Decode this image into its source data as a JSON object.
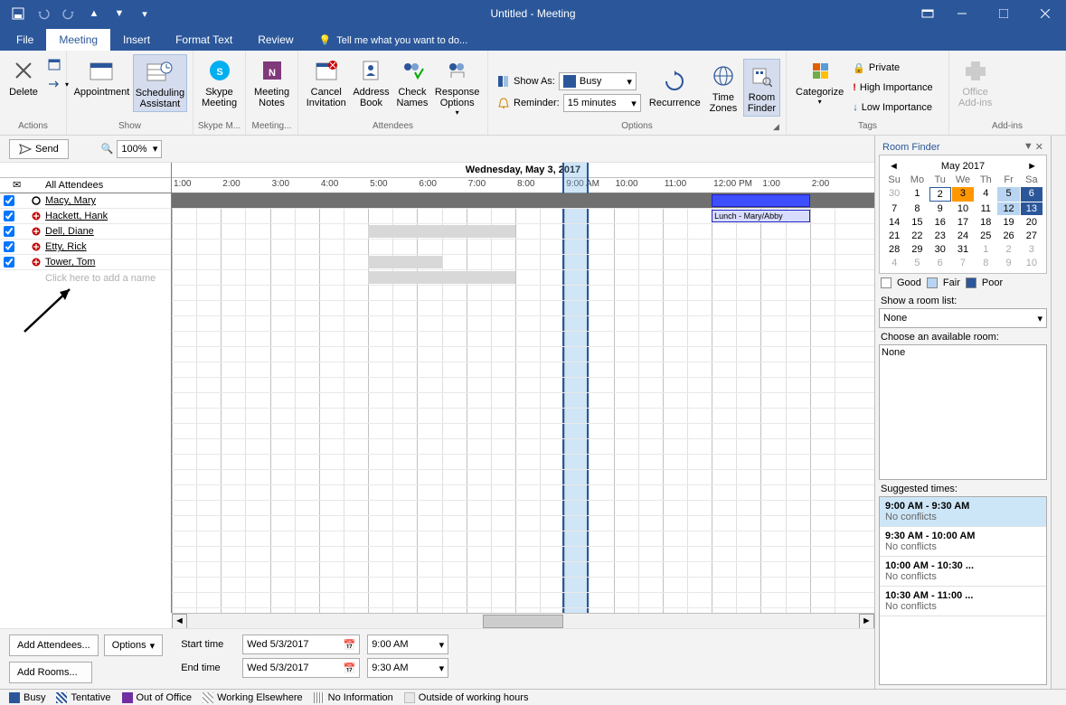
{
  "window": {
    "title": "Untitled - Meeting"
  },
  "tabs": {
    "file": "File",
    "meeting": "Meeting",
    "insert": "Insert",
    "formattext": "Format Text",
    "review": "Review",
    "tellme": "Tell me what you want to do..."
  },
  "ribbon": {
    "actions": {
      "delete": "Delete",
      "group": "Actions"
    },
    "show": {
      "appointment": "Appointment",
      "scheduling": "Scheduling\nAssistant",
      "group": "Show"
    },
    "skype": {
      "btn": "Skype\nMeeting",
      "group": "Skype M..."
    },
    "notes": {
      "btn": "Meeting\nNotes",
      "group": "Meeting..."
    },
    "attendees": {
      "cancel": "Cancel\nInvitation",
      "address": "Address\nBook",
      "check": "Check\nNames",
      "response": "Response\nOptions",
      "group": "Attendees"
    },
    "options": {
      "showas_lbl": "Show As:",
      "showas_val": "Busy",
      "reminder_lbl": "Reminder:",
      "reminder_val": "15 minutes",
      "recurrence": "Recurrence",
      "timezones": "Time\nZones",
      "roomfinder": "Room\nFinder",
      "group": "Options"
    },
    "tags": {
      "categorize": "Categorize",
      "private": "Private",
      "high": "High Importance",
      "low": "Low Importance",
      "group": "Tags"
    },
    "addins": {
      "btn": "Office\nAdd-ins",
      "group": "Add-ins"
    }
  },
  "toolbar": {
    "send": "Send",
    "zoom": "100%"
  },
  "schedule": {
    "date": "Wednesday, May 3, 2017",
    "hours": [
      "1:00",
      "2:00",
      "3:00",
      "4:00",
      "5:00",
      "6:00",
      "7:00",
      "8:00",
      "9:00 AM",
      "10:00",
      "11:00",
      "12:00 PM",
      "1:00",
      "2:00"
    ],
    "all_head": "All Attendees",
    "attendees": [
      {
        "name": "Macy, Mary",
        "role": "organizer"
      },
      {
        "name": "Hackett, Hank",
        "role": "required"
      },
      {
        "name": "Dell, Diane",
        "role": "required"
      },
      {
        "name": "Etty, Rick",
        "role": "required"
      },
      {
        "name": "Tower, Tom",
        "role": "required"
      }
    ],
    "add_placeholder": "Click here to add a name",
    "lunch_label": "Lunch - Mary/Abby"
  },
  "bottom": {
    "add_attendees": "Add Attendees...",
    "options": "Options",
    "add_rooms": "Add Rooms...",
    "start_lbl": "Start time",
    "end_lbl": "End time",
    "start_date": "Wed 5/3/2017",
    "end_date": "Wed 5/3/2017",
    "start_time": "9:00 AM",
    "end_time": "9:30 AM"
  },
  "roomfinder": {
    "title": "Room Finder",
    "month": "May 2017",
    "dow": [
      "Su",
      "Mo",
      "Tu",
      "We",
      "Th",
      "Fr",
      "Sa"
    ],
    "legend": {
      "good": "Good",
      "fair": "Fair",
      "poor": "Poor"
    },
    "show_list_lbl": "Show a room list:",
    "show_list_val": "None",
    "choose_lbl": "Choose an available room:",
    "choose_val": "None",
    "suggested_lbl": "Suggested times:",
    "suggestions": [
      {
        "time": "9:00 AM - 9:30 AM",
        "conf": "No conflicts"
      },
      {
        "time": "9:30 AM - 10:00 AM",
        "conf": "No conflicts"
      },
      {
        "time": "10:00 AM - 10:30 ...",
        "conf": "No conflicts"
      },
      {
        "time": "10:30 AM - 11:00 ...",
        "conf": "No conflicts"
      }
    ]
  },
  "legend": {
    "busy": "Busy",
    "tentative": "Tentative",
    "oof": "Out of Office",
    "elsewhere": "Working Elsewhere",
    "noinfo": "No Information",
    "outside": "Outside of working hours"
  }
}
